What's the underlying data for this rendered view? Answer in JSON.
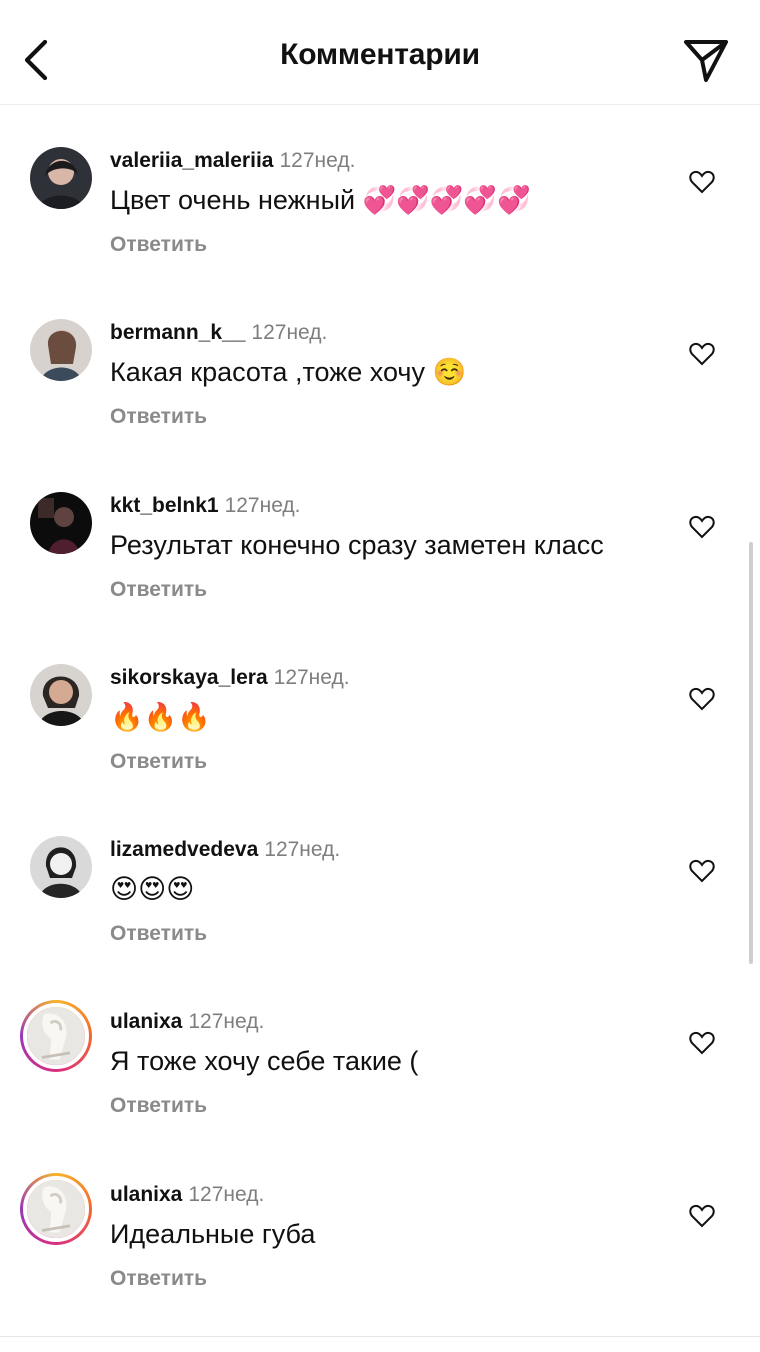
{
  "header": {
    "title": "Комментарии"
  },
  "comments": [
    {
      "username": "valeriia_maleriia",
      "time": "127нед.",
      "text": "Цвет очень нежный 💞💞💞💞💞",
      "reply": "Ответить",
      "avatar_icon": "profile-photo",
      "story_ring": false
    },
    {
      "username": "bermann_k__",
      "time": "127нед.",
      "text": "Какая красота ,тоже хочу ☺️",
      "reply": "Ответить",
      "avatar_icon": "profile-photo",
      "story_ring": false
    },
    {
      "username": "kkt_belnk1",
      "time": "127нед.",
      "text": "Результат конечно сразу заметен класс",
      "reply": "Ответить",
      "avatar_icon": "profile-photo",
      "story_ring": false
    },
    {
      "username": "sikorskaya_lera",
      "time": "127нед.",
      "text": "🔥🔥🔥",
      "reply": "Ответить",
      "avatar_icon": "profile-photo",
      "story_ring": false
    },
    {
      "username": "lizamedvedeva",
      "time": "127нед.",
      "text": "😍😍😍",
      "reply": "Ответить",
      "avatar_icon": "profile-photo",
      "story_ring": false
    },
    {
      "username": "ulanixa",
      "time": "127нед.",
      "text": "Я тоже хочу себе такие (",
      "reply": "Ответить",
      "avatar_icon": "profile-photo",
      "story_ring": true
    },
    {
      "username": "ulanixa",
      "time": "127нед.",
      "text": "Идеальные губа",
      "reply": "Ответить",
      "avatar_icon": "profile-photo",
      "story_ring": true
    }
  ],
  "colors": {
    "text": "#111111",
    "muted": "#7e7e7e",
    "reply": "#8a8a8a",
    "divider": "#ececec",
    "story_ring": [
      "#f7b52b",
      "#f26730",
      "#d92e7f",
      "#9b36b7"
    ]
  }
}
